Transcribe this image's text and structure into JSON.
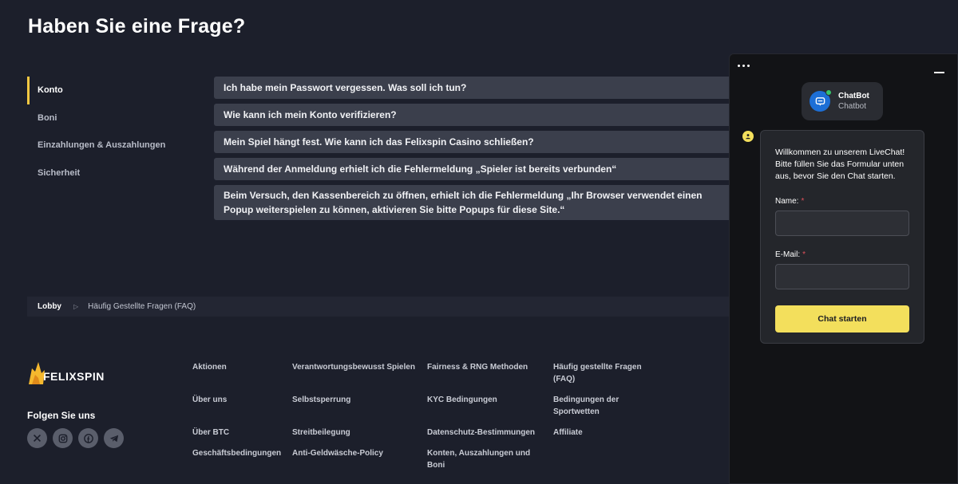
{
  "page": {
    "title": "Haben Sie eine Frage?"
  },
  "faq_nav": [
    {
      "label": "Konto",
      "active": true
    },
    {
      "label": "Boni",
      "active": false
    },
    {
      "label": "Einzahlungen & Auszahlungen",
      "active": false
    },
    {
      "label": "Sicherheit",
      "active": false
    }
  ],
  "faq_items": [
    "Ich habe mein Passwort vergessen. Was soll ich tun?",
    "Wie kann ich mein Konto verifizieren?",
    "Mein Spiel hängt fest. Wie kann ich das Felixspin Casino schließen?",
    "Während der Anmeldung erhielt ich die Fehlermeldung „Spieler ist bereits verbunden“",
    "Beim Versuch, den Kassenbereich zu öffnen, erhielt ich die Fehlermeldung „Ihr Browser verwendet einen Popup weiterspielen zu können, aktivieren Sie bitte Popups für diese Site.“"
  ],
  "breadcrumb": {
    "lobby": "Lobby",
    "separator": "▷",
    "current": "Häufig Gestellte Fragen (FAQ)"
  },
  "footer": {
    "logo_text": "FELIXSPIN",
    "follow_title": "Folgen Sie uns",
    "social": [
      "x-icon",
      "instagram-icon",
      "facebook-icon",
      "telegram-icon"
    ],
    "col1": [
      "Aktionen",
      "Über uns",
      "Über BTC",
      "Geschäftsbedingungen"
    ],
    "col2": [
      "Verantwortungsbewusst Spielen",
      "Selbstsperrung",
      "Streitbeilegung",
      "Anti-Geldwäsche-Policy"
    ],
    "col3": [
      "Fairness & RNG Methoden",
      "KYC Bedingungen",
      "Datenschutz-Bestimmungen",
      "Konten, Auszahlungen und Boni"
    ],
    "col4": [
      "Häufig gestellte Fragen (FAQ)",
      "Bedingungen der Sportwetten",
      "Affiliate"
    ]
  },
  "chat": {
    "bot_name": "ChatBot",
    "bot_subtitle": "Chatbot",
    "welcome": "Willkommen zu unserem LiveChat! Bitte füllen Sie das Formular unten aus, bevor Sie den Chat starten.",
    "name_label": "Name:",
    "email_label": "E-Mail:",
    "required_mark": "*",
    "start_button": "Chat starten"
  },
  "colors": {
    "accent": "#f3df5c",
    "background": "#1c1f2b",
    "faq_item": "#3b3f4c",
    "chat_bg": "#121316",
    "bot_avatar": "#1d6fd6"
  }
}
